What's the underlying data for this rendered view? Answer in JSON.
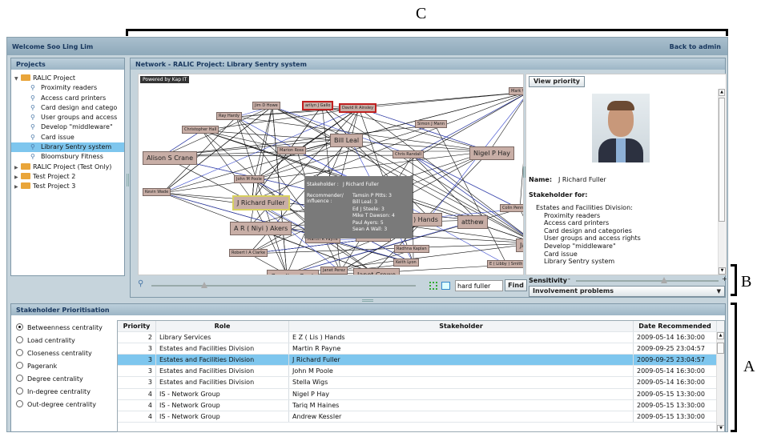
{
  "annotations": {
    "c": "C",
    "b": "B",
    "a": "A"
  },
  "header": {
    "welcome": "Welcome Soo Ling Lim",
    "back": "Back to admin"
  },
  "projects": {
    "title": "Projects",
    "items": [
      {
        "label": "RALIC Project",
        "type": "folder",
        "open": true
      },
      {
        "label": "Proximity readers",
        "type": "query"
      },
      {
        "label": "Access card printers",
        "type": "query"
      },
      {
        "label": "Card design and catego",
        "type": "query"
      },
      {
        "label": "User groups and access",
        "type": "query"
      },
      {
        "label": "Develop \"middleware\"",
        "type": "query"
      },
      {
        "label": "Card issue",
        "type": "query"
      },
      {
        "label": "Library Sentry system",
        "type": "query",
        "selected": true
      },
      {
        "label": "Bloomsbury Fitness",
        "type": "query"
      },
      {
        "label": "RALIC Project (Test Only)",
        "type": "folder"
      },
      {
        "label": "Test Project 2",
        "type": "folder"
      },
      {
        "label": "Test Project 3",
        "type": "folder"
      }
    ]
  },
  "network": {
    "title": "Network - RALIC Project: Library Sentry system",
    "powered": "Powered by Kap IT",
    "nodes": [
      "Mark W",
      "arilyn J Gallo",
      "David R Ainsley",
      "Jim D Howe",
      "Ray Hardy",
      "Simon J Mann",
      "Christopher Hall",
      "Bill Leal",
      "Marion Ross",
      "Chris Randall",
      "Nigel P Hay",
      "Alison S Crane",
      "John M Poole",
      "Kevin Wade",
      "J Richard Fuller",
      "Colin Penn",
      "atthew",
      ") Hands",
      "A R ( Niyi ) Akers",
      "Martin R Payne",
      "Mike T Dawson",
      "Jas",
      "Robert I A Clarke",
      "Radhna Kaplan",
      "E ( Libby ) Smith",
      "Keith Lyon",
      "Caroline Cook",
      "Janet Perez",
      "Janet Crowe"
    ],
    "tooltip": {
      "stakeholder_label": "Stakeholder :",
      "stakeholder": "J Richard Fuller",
      "rec_label": "Recommender/ influence :",
      "recs": [
        "Tamsin P Pitts: 3",
        "Bill Leal: 3",
        "Ed J Steele: 3",
        "Mike T Dawson: 4",
        "Paul Ayers: 5",
        "Sean A Wall: 3"
      ]
    },
    "search_value": "hard fuller",
    "find": "Find"
  },
  "info": {
    "view_priority": "View priority",
    "name_label": "Name:",
    "name": "J Richard Fuller",
    "for_label": "Stakeholder for:",
    "for_items": [
      "Estates and Facilities Division:",
      "Proximity readers",
      "Access card printers",
      "Card design and categories",
      "User groups and access rights",
      "Develop \"middleware\"",
      "Card issue",
      "Library Sentry system"
    ],
    "sensitivity": "Sensitivity",
    "minus": "-",
    "plus": "+",
    "sensitivity_level": 0.62,
    "involvement": "Involvement problems"
  },
  "prioritisation": {
    "title": "Stakeholder Prioritisation",
    "measures": [
      {
        "label": "Betweenness centrality",
        "on": true
      },
      {
        "label": "Load centrality"
      },
      {
        "label": "Closeness centrality"
      },
      {
        "label": "Pagerank"
      },
      {
        "label": "Degree centrality"
      },
      {
        "label": "In-degree centrality"
      },
      {
        "label": "Out-degree centrality"
      }
    ],
    "columns": [
      "Priority",
      "Role",
      "Stakeholder",
      "Date Recommended"
    ],
    "rows": [
      [
        "2",
        "Library Services",
        "E Z ( Lis ) Hands",
        "2009-05-14 16:30:00"
      ],
      [
        "3",
        "Estates and Facilities Division",
        "Martin R Payne",
        "2009-09-25 23:04:57"
      ],
      [
        "3",
        "Estates and Facilities Division",
        "J Richard Fuller",
        "2009-09-25 23:04:57"
      ],
      [
        "3",
        "Estates and Facilities Division",
        "John M Poole",
        "2009-05-14 16:30:00"
      ],
      [
        "3",
        "Estates and Facilities Division",
        "Stella Wigs",
        "2009-05-14 16:30:00"
      ],
      [
        "4",
        "IS - Network Group",
        "Nigel P Hay",
        "2009-05-15 13:30:00"
      ],
      [
        "4",
        "IS - Network Group",
        "Tariq M Haines",
        "2009-05-15 13:30:00"
      ],
      [
        "4",
        "IS - Network Group",
        "Andrew Kessler",
        "2009-05-15 13:30:00"
      ]
    ],
    "selected_row": 2
  }
}
